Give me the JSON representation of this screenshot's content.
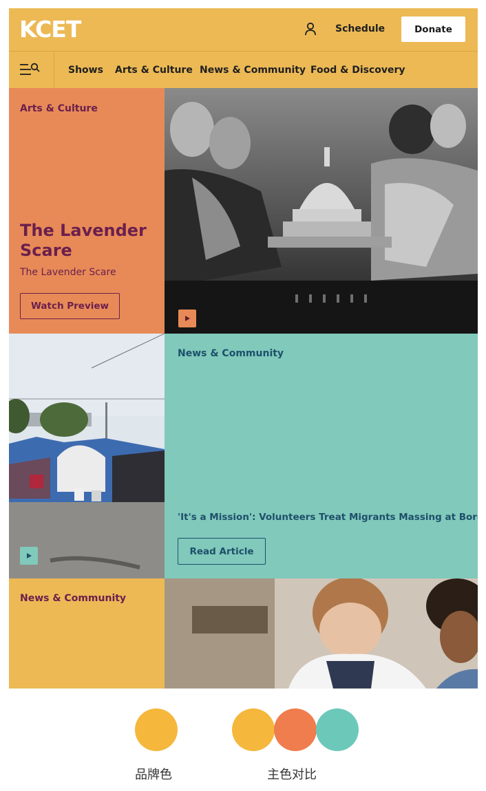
{
  "header": {
    "logo": "KCET",
    "schedule_label": "Schedule",
    "donate_label": "Donate"
  },
  "nav": {
    "items": [
      "Shows",
      "Arts & Culture",
      "News & Community",
      "Food & Discovery"
    ]
  },
  "feature1": {
    "category": "Arts & Culture",
    "title_line1": "The Lavender",
    "title_line2": "Scare",
    "subtitle": "The Lavender Scare",
    "button_label": "Watch Preview"
  },
  "feature2": {
    "category": "News & Community",
    "headline": "'It's a Mission': Volunteers Treat Migrants Massing at Border",
    "button_label": "Read Article"
  },
  "feature3": {
    "category": "News & Community"
  },
  "palette": {
    "brand_label": "品牌色",
    "contrast_label": "主色对比",
    "brand_color": "#f5b73c",
    "accent_orange": "#ef7d4e",
    "accent_teal": "#6cc9ba"
  },
  "colors": {
    "header_yellow": "#ecb955",
    "panel_orange": "#e88a57",
    "panel_teal": "#80c9bb",
    "title_purple": "#6a1f4d",
    "text_teal_dark": "#1e4f6a"
  },
  "icons": [
    "user-icon",
    "menu-search-icon",
    "play-icon"
  ]
}
